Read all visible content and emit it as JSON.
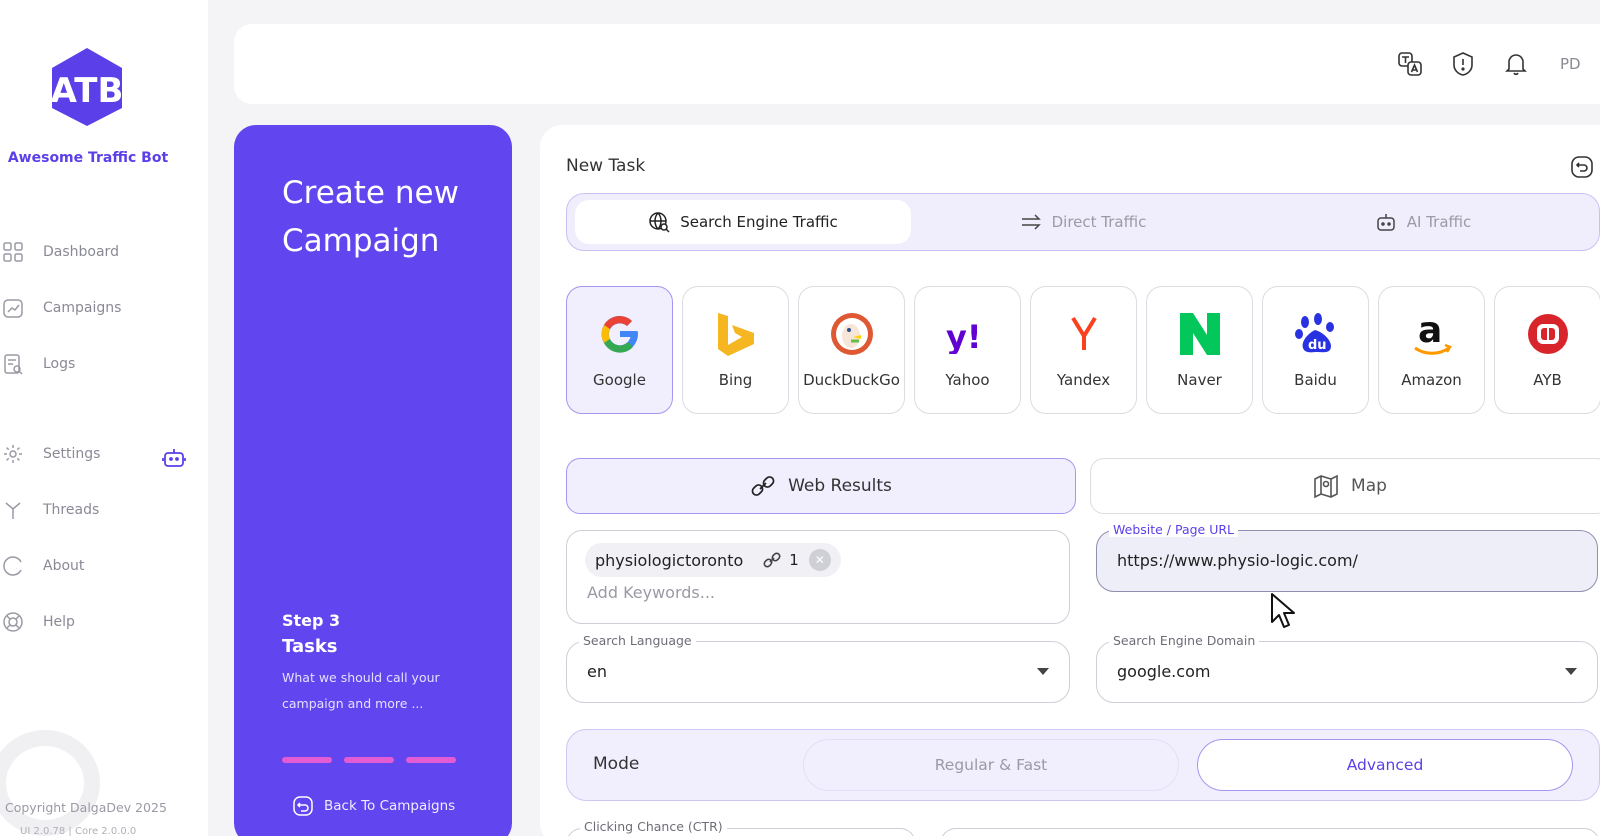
{
  "sidebar": {
    "brand": "Awesome Traffic Bot",
    "items": [
      {
        "label": "Dashboard",
        "icon": "dashboard-icon"
      },
      {
        "label": "Campaigns",
        "icon": "campaigns-icon"
      },
      {
        "label": "Logs",
        "icon": "logs-icon"
      },
      {
        "label": "Settings",
        "icon": "gear-icon"
      },
      {
        "label": "Threads",
        "icon": "threads-icon"
      },
      {
        "label": "About",
        "icon": "about-icon"
      },
      {
        "label": "Help",
        "icon": "help-icon"
      }
    ],
    "copyright": "Copyright DalgaDev 2025",
    "version": "UI 2.0.78 | Core 2.0.0.0"
  },
  "topbar": {
    "initials": "PD",
    "icons": [
      "translate-icon",
      "alert-icon",
      "bell-icon"
    ]
  },
  "campaign_panel": {
    "title": "Create new Campaign",
    "step_number": "Step 3",
    "step_title": "Tasks",
    "step_description": "What we should call your campaign and more ...",
    "back_label": "Back To Campaigns",
    "progress_color": "#e45bd6"
  },
  "task": {
    "title": "New Task",
    "traffic_tabs": [
      {
        "label": "Search Engine Traffic",
        "active": true
      },
      {
        "label": "Direct Traffic",
        "active": false
      },
      {
        "label": "AI Traffic",
        "active": false
      }
    ],
    "engines": [
      {
        "name": "Google",
        "active": true
      },
      {
        "name": "Bing",
        "active": false
      },
      {
        "name": "DuckDuckGo",
        "active": false
      },
      {
        "name": "Yahoo",
        "active": false
      },
      {
        "name": "Yandex",
        "active": false
      },
      {
        "name": "Naver",
        "active": false
      },
      {
        "name": "Baidu",
        "active": false
      },
      {
        "name": "Amazon",
        "active": false
      },
      {
        "name": "AYB",
        "active": false
      }
    ],
    "result_tabs": {
      "web": "Web Results",
      "map": "Map"
    },
    "keywords": {
      "chip_text": "physiologictoronto",
      "chip_count": "1",
      "placeholder": "Add Keywords..."
    },
    "url_field": {
      "label": "Website / Page URL",
      "value": "https://www.physio-logic.com/"
    },
    "language_field": {
      "label": "Search Language",
      "value": "en"
    },
    "domain_field": {
      "label": "Search Engine Domain",
      "value": "google.com"
    },
    "mode": {
      "label": "Mode",
      "regular": "Regular & Fast",
      "advanced": "Advanced",
      "selected": "Advanced"
    },
    "ctr_label": "Clicking Chance (CTR)"
  },
  "colors": {
    "accent": "#6145ef",
    "accent_text": "#5b3fe8",
    "active_bg": "#f1eefd"
  }
}
